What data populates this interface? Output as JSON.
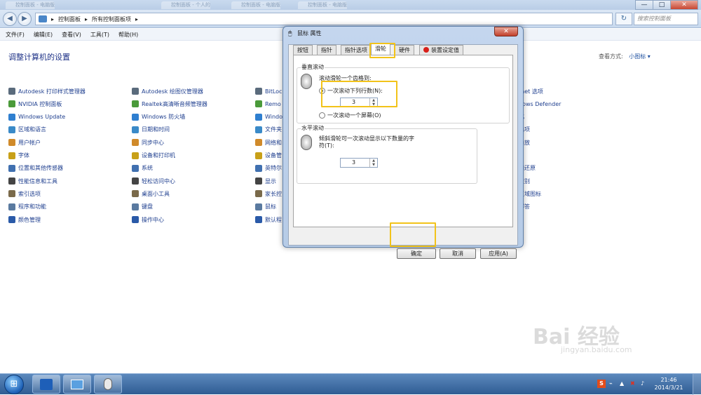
{
  "window": {
    "ghost_tabs": [
      "控制面板 - 电脑版面",
      "控制面板 - 个人的设置",
      "控制面板 - 电脑版面",
      "控制面板 - 电脑版面"
    ],
    "address": {
      "segments": [
        "控制面板",
        "▸",
        "所有控制面板项",
        "▸"
      ]
    },
    "search_placeholder": "搜索控制面板",
    "controls": {
      "minimize": "—",
      "maximize": "□",
      "close": "✕"
    }
  },
  "menubar": [
    "文件(F)",
    "编辑(E)",
    "查看(V)",
    "工具(T)",
    "帮助(H)"
  ],
  "control_panel": {
    "title": "调整计算机的设置",
    "view_by_label": "查看方式:",
    "view_by_value": "小图标 ▾",
    "col1": [
      "Autodesk 打印样式管理器",
      "NVIDIA 控制面板",
      "Windows Update",
      "区域和语言",
      "用户帐户",
      "字体",
      "位置和其他传感器",
      "性能信息和工具",
      "索引选项",
      "程序和功能",
      "颜色管理"
    ],
    "col2": [
      "Autodesk 绘图仪管理器",
      "Realtek高清晰音频管理器",
      "Windows 防火墙",
      "日期和时间",
      "同步中心",
      "设备和打印机",
      "系统",
      "轻松访问中心",
      "桌面小工具",
      "键盘",
      "操作中心"
    ],
    "col3": [
      "BitLoc",
      "Remo",
      "Windo",
      "文件夹",
      "网络和",
      "设备管",
      "英特尔",
      "显示",
      "家长控",
      "鼠标",
      "默认程"
    ],
    "col4": [
      "rnet 选项",
      "dows Defender",
      "化",
      "选项",
      "播放",
      "",
      "和还原",
      "识别",
      "区域图标",
      "解答",
      ""
    ]
  },
  "dialog": {
    "title": "鼠标 属性",
    "close": "✕",
    "tabs": [
      "按钮",
      "指针",
      "指针选项",
      "滑轮",
      "硬件",
      "装置设定值"
    ],
    "vertical": {
      "label": "垂直滚动",
      "desc": "滚动滑轮一个齿格到:",
      "option1": "一次滚动下列行数(N):",
      "value": "3",
      "option2": "一次滚动一个屏幕(O)"
    },
    "horizontal": {
      "label": "水平滚动",
      "desc1": "倾斜滑轮可一次滚动显示以下数量的字",
      "desc2": "符(T):",
      "value": "3"
    },
    "buttons": {
      "ok": "确定",
      "cancel": "取消",
      "apply": "应用(A)"
    }
  },
  "taskbar": {
    "start": "⊞",
    "tray_s": "S",
    "clock_time": "21:46",
    "clock_date": "2014/3/21"
  },
  "watermark": {
    "main": "Bai 经验",
    "sub": "jingyan.baidu.com"
  },
  "colors": {
    "highlight": "#f2c31a",
    "link": "#1f3f8f",
    "title": "#1e3287"
  }
}
